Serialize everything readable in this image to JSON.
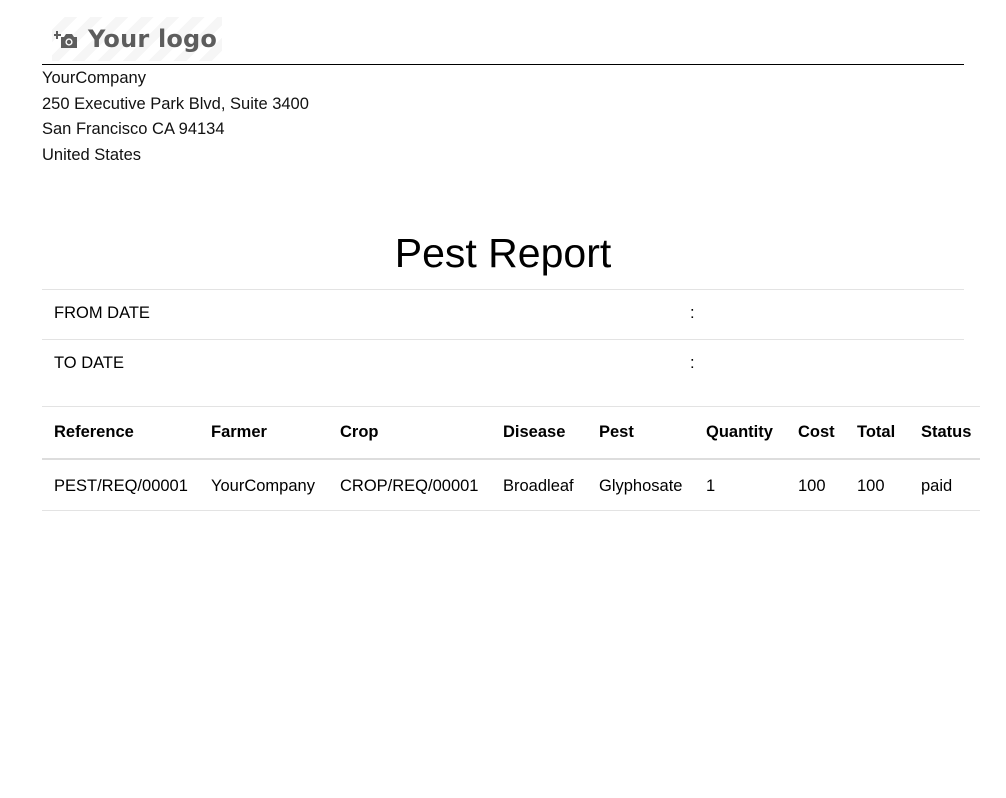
{
  "header": {
    "logo_text": "Your logo",
    "logo_icon": "camera-add-icon"
  },
  "company": {
    "name": "YourCompany",
    "address_line1": "250 Executive Park Blvd, Suite 3400",
    "address_line2": "San Francisco CA 94134",
    "country": "United States"
  },
  "report": {
    "title": "Pest Report",
    "filters": [
      {
        "label": "FROM DATE",
        "separator": ":"
      },
      {
        "label": "TO DATE",
        "separator": ":"
      }
    ]
  },
  "table": {
    "columns": [
      "Reference",
      "Farmer",
      "Crop",
      "Disease",
      "Pest",
      "Quantity",
      "Cost",
      "Total",
      "Status"
    ],
    "rows": [
      [
        "PEST/REQ/00001",
        "YourCompany",
        "CROP/REQ/00001",
        "Broadleaf",
        "Glyphosate",
        "1",
        "100",
        "100",
        "paid"
      ]
    ]
  }
}
